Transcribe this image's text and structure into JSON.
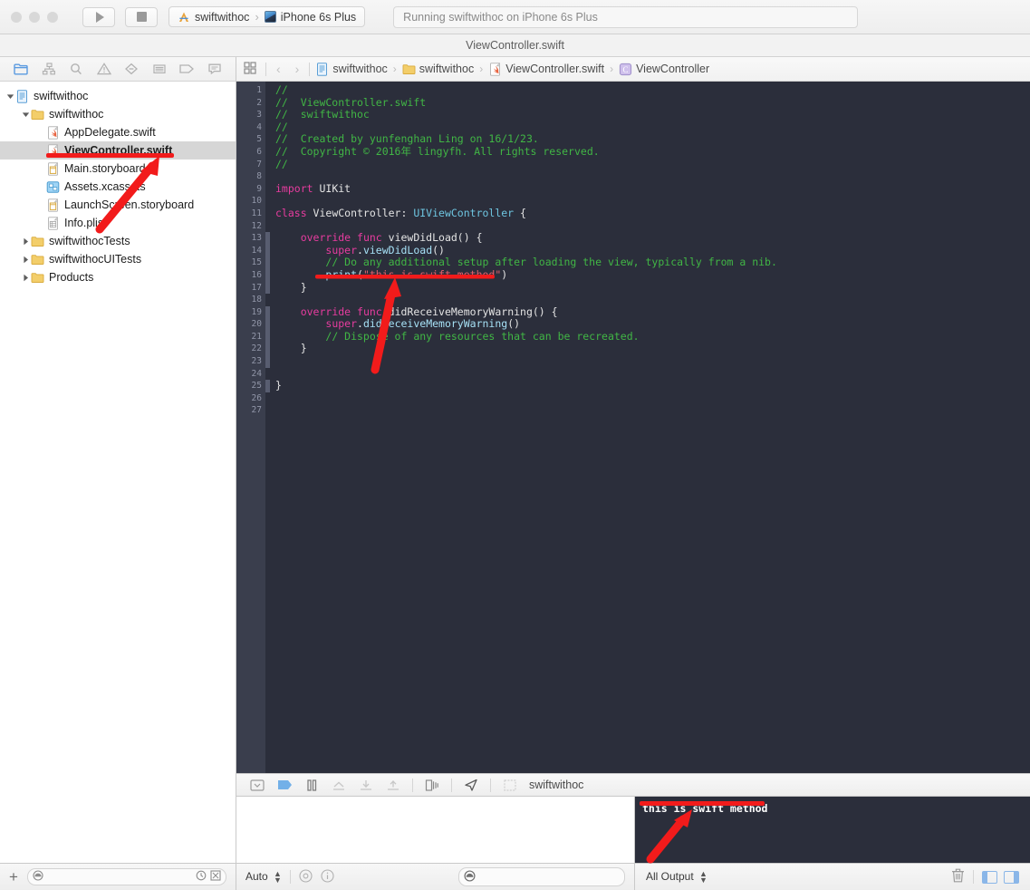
{
  "window": {
    "title": "ViewController.swift",
    "status_message": "Running swiftwithoc on iPhone 6s Plus"
  },
  "toolbar": {
    "run_label": "Run",
    "stop_label": "Stop",
    "scheme_name": "swiftwithoc",
    "scheme_separator": "›",
    "destination": "iPhone 6s Plus"
  },
  "navigator": {
    "toolbar_icons": [
      "folder-icon",
      "source-control-icon",
      "search-icon",
      "warning-icon",
      "breakpoint-icon",
      "report-icon",
      "tag-icon",
      "comment-icon"
    ],
    "tree": [
      {
        "label": "swiftwithoc",
        "indent": 0,
        "icon": "project-icon",
        "twist": "down",
        "selected": false
      },
      {
        "label": "swiftwithoc",
        "indent": 1,
        "icon": "folder-icon",
        "twist": "down",
        "selected": false
      },
      {
        "label": "AppDelegate.swift",
        "indent": 2,
        "icon": "swift-file-icon",
        "twist": "none",
        "selected": false
      },
      {
        "label": "ViewController.swift",
        "indent": 2,
        "icon": "swift-file-icon",
        "twist": "none",
        "selected": true
      },
      {
        "label": "Main.storyboard",
        "indent": 2,
        "icon": "storyboard-icon",
        "twist": "none",
        "selected": false
      },
      {
        "label": "Assets.xcassets",
        "indent": 2,
        "icon": "assets-icon",
        "twist": "none",
        "selected": false
      },
      {
        "label": "LaunchScreen.storyboard",
        "indent": 2,
        "icon": "storyboard-icon",
        "twist": "none",
        "selected": false
      },
      {
        "label": "Info.plist",
        "indent": 2,
        "icon": "plist-icon",
        "twist": "none",
        "selected": false
      },
      {
        "label": "swiftwithocTests",
        "indent": 1,
        "icon": "folder-icon",
        "twist": "right",
        "selected": false
      },
      {
        "label": "swiftwithocUITests",
        "indent": 1,
        "icon": "folder-icon",
        "twist": "right",
        "selected": false
      },
      {
        "label": "Products",
        "indent": 1,
        "icon": "folder-icon",
        "twist": "right",
        "selected": false
      }
    ],
    "filter_placeholder": ""
  },
  "jumpbar": {
    "related_items_icon": "grid-icon",
    "back_icon": "chevron-left-icon",
    "forward_icon": "chevron-right-icon",
    "breadcrumbs": [
      {
        "label": "swiftwithoc",
        "icon": "project-icon"
      },
      {
        "label": "swiftwithoc",
        "icon": "folder-icon"
      },
      {
        "label": "ViewController.swift",
        "icon": "swift-file-icon"
      },
      {
        "label": "ViewController",
        "icon": "class-icon"
      }
    ],
    "separator": "›"
  },
  "editor": {
    "total_lines": 27,
    "edited_lines": [
      13,
      14,
      15,
      16,
      17,
      19,
      20,
      21,
      22,
      23,
      25
    ],
    "lines": [
      {
        "n": 1,
        "tokens": [
          {
            "t": "c",
            "v": "//"
          }
        ]
      },
      {
        "n": 2,
        "tokens": [
          {
            "t": "c",
            "v": "//  ViewController.swift"
          }
        ]
      },
      {
        "n": 3,
        "tokens": [
          {
            "t": "c",
            "v": "//  swiftwithoc"
          }
        ]
      },
      {
        "n": 4,
        "tokens": [
          {
            "t": "c",
            "v": "//"
          }
        ]
      },
      {
        "n": 5,
        "tokens": [
          {
            "t": "c",
            "v": "//  Created by yunfenghan Ling on 16/1/23."
          }
        ]
      },
      {
        "n": 6,
        "tokens": [
          {
            "t": "c",
            "v": "//  Copyright © 2016年 lingyfh. All rights reserved."
          }
        ]
      },
      {
        "n": 7,
        "tokens": [
          {
            "t": "c",
            "v": "//"
          }
        ]
      },
      {
        "n": 8,
        "tokens": []
      },
      {
        "n": 9,
        "tokens": [
          {
            "t": "k",
            "v": "import"
          },
          {
            "t": "f",
            "v": " UIKit"
          }
        ]
      },
      {
        "n": 10,
        "tokens": []
      },
      {
        "n": 11,
        "tokens": [
          {
            "t": "k",
            "v": "class"
          },
          {
            "t": "f",
            "v": " ViewController: "
          },
          {
            "t": "t",
            "v": "UIViewController"
          },
          {
            "t": "f",
            "v": " {"
          }
        ]
      },
      {
        "n": 12,
        "tokens": []
      },
      {
        "n": 13,
        "tokens": [
          {
            "t": "f",
            "v": "    "
          },
          {
            "t": "k",
            "v": "override func"
          },
          {
            "t": "f",
            "v": " viewDidLoad() {"
          }
        ]
      },
      {
        "n": 14,
        "tokens": [
          {
            "t": "f",
            "v": "        "
          },
          {
            "t": "k",
            "v": "super"
          },
          {
            "t": "f",
            "v": "."
          },
          {
            "t": "m",
            "v": "viewDidLoad"
          },
          {
            "t": "f",
            "v": "()"
          }
        ]
      },
      {
        "n": 15,
        "tokens": [
          {
            "t": "f",
            "v": "        "
          },
          {
            "t": "c",
            "v": "// Do any additional setup after loading the view, typically from a nib."
          }
        ]
      },
      {
        "n": 16,
        "tokens": [
          {
            "t": "f",
            "v": "        "
          },
          {
            "t": "m",
            "v": "print"
          },
          {
            "t": "f",
            "v": "("
          },
          {
            "t": "s",
            "v": "\"this is swift method\""
          },
          {
            "t": "f",
            "v": ")"
          }
        ]
      },
      {
        "n": 17,
        "tokens": [
          {
            "t": "f",
            "v": "    }"
          }
        ]
      },
      {
        "n": 18,
        "tokens": []
      },
      {
        "n": 19,
        "tokens": [
          {
            "t": "f",
            "v": "    "
          },
          {
            "t": "k",
            "v": "override func"
          },
          {
            "t": "f",
            "v": " didReceiveMemoryWarning() {"
          }
        ]
      },
      {
        "n": 20,
        "tokens": [
          {
            "t": "f",
            "v": "        "
          },
          {
            "t": "k",
            "v": "super"
          },
          {
            "t": "f",
            "v": "."
          },
          {
            "t": "m",
            "v": "didReceiveMemoryWarning"
          },
          {
            "t": "f",
            "v": "()"
          }
        ]
      },
      {
        "n": 21,
        "tokens": [
          {
            "t": "f",
            "v": "        "
          },
          {
            "t": "c",
            "v": "// Dispose of any resources that can be recreated."
          }
        ]
      },
      {
        "n": 22,
        "tokens": [
          {
            "t": "f",
            "v": "    }"
          }
        ]
      },
      {
        "n": 23,
        "tokens": []
      },
      {
        "n": 24,
        "tokens": []
      },
      {
        "n": 25,
        "tokens": [
          {
            "t": "f",
            "v": "}"
          }
        ]
      },
      {
        "n": 26,
        "tokens": []
      },
      {
        "n": 27,
        "tokens": []
      }
    ]
  },
  "debug_bar": {
    "hide_label": "Hide/Show debug area",
    "icons": [
      "hide-debug-area-icon",
      "deactivate-breakpoints-icon",
      "pause-icon",
      "step-over-icon",
      "step-into-icon",
      "step-out-icon",
      "view-hierarchy-icon",
      "location-simulate-icon",
      "stack-frame-icon"
    ],
    "process_name": "swiftwithoc"
  },
  "console": {
    "output": "this is swift method"
  },
  "variables_bar": {
    "scope_label": "Auto",
    "eye_icon": "eye-icon",
    "info_icon": "info-icon",
    "search_placeholder": ""
  },
  "output_bar": {
    "filter_label": "All Output",
    "trash_icon": "trash-icon",
    "left_pane_icon": "show-variables-pane-icon",
    "right_pane_icon": "show-console-pane-icon"
  },
  "status_bar_left": {
    "add_label": "+",
    "filter_placeholder": "",
    "recent_icon": "clock-icon",
    "sourcecontrol_icon": "filter-icon"
  },
  "colors": {
    "editor_bg": "#2b2e3b",
    "gutter_bg": "#3a3e4d",
    "comment": "#41b645",
    "keyword": "#e73c9f",
    "type": "#6ec5e0",
    "string": "#e15f6b",
    "method": "#a6e0f5",
    "annotation_red": "#f21b1b",
    "selection": "#d6d6d6"
  },
  "annotations": [
    {
      "name": "underline-viewcontroller-file",
      "type": "line"
    },
    {
      "name": "arrow-to-viewcontroller-file",
      "type": "arrow"
    },
    {
      "name": "underline-print-statement",
      "type": "line"
    },
    {
      "name": "arrow-to-print-statement",
      "type": "arrow"
    },
    {
      "name": "underline-console-output",
      "type": "line"
    },
    {
      "name": "arrow-to-console-output",
      "type": "arrow"
    }
  ]
}
